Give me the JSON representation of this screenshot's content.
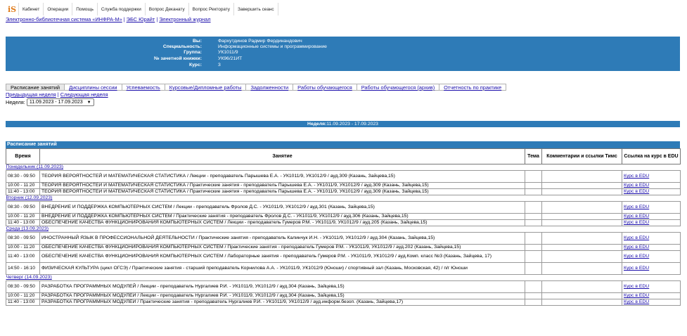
{
  "logo": "iS",
  "top_menu": [
    "Кабинет",
    "Операции",
    "Помощь",
    "Служба поддержки",
    "Вопрос Деканату",
    "Вопрос Ректорату",
    "Завершить сеанс"
  ],
  "ext_links": [
    "Электронно-библиотечная система «ИНФРА-М»",
    "ЭБС Юрайт",
    "Электронный журнал"
  ],
  "ext_links_sep": "|",
  "student": [
    {
      "label": "Вы:",
      "value": "Фархутдинов Радмир Фердинандович"
    },
    {
      "label": "Специальность:",
      "value": "Информационные системы и программирование"
    },
    {
      "label": "Группа:",
      "value": "УК1011/9"
    },
    {
      "label": "№ зачетной книжки:",
      "value": "УК96/21ИТ"
    },
    {
      "label": "Курс:",
      "value": "3"
    }
  ],
  "tabs": [
    "Расписание занятий",
    "Дисциплины сессии",
    "Успеваемость",
    "Курсовые/Дипломные работы",
    "Задолженности",
    "Работы обучающегося",
    "Работы обучающегося (архив)",
    "Отчетность по практике"
  ],
  "week_nav": {
    "prev": "Предыдущая неделя",
    "next": "Следующая неделя",
    "sep": "|"
  },
  "week_select": {
    "label": "Неделя:",
    "value": "11.09.2023 - 17.09.2023"
  },
  "week_bar": {
    "label": "Неделя:",
    "value": "11.09.2023 - 17.09.2023"
  },
  "schedule": {
    "title": "Расписание занятий",
    "headers": [
      "Время",
      "Занятие",
      "Тема",
      "Комментарии и ссылки Тимс",
      "Ссылка на курс в EDU"
    ],
    "link_text": "Курс в EDU",
    "days": [
      {
        "day": "Понедельник (11.09.2023)",
        "rows": [
          {
            "time": "08:30 - 09:50",
            "lesson": "ТЕОРИЯ ВЕРОЯТНОСТЕЙ И МАТЕМАТИЧЕСКАЯ СТАТИСТИКА / Лекции - преподаватель Парышева Е.А. - УК1011/9, УК1012/9 / ауд.309 (Казань, Зайцева,15)",
            "tall": true
          },
          {
            "time": "10:00 - 11:20",
            "lesson": "ТЕОРИЯ ВЕРОЯТНОСТЕЙ И МАТЕМАТИЧЕСКАЯ СТАТИСТИКА / Практические занятия - преподаватель Парышева Е.А. - УК1011/9, УК1012/9 / ауд.309 (Казань, Зайцева,15)",
            "tall": false
          },
          {
            "time": "11:40 - 13:00",
            "lesson": "ТЕОРИЯ ВЕРОЯТНОСТЕЙ И МАТЕМАТИЧЕСКАЯ СТАТИСТИКА / Практические занятия - преподаватель Парышева Е.А. - УК1011/9, УК1012/9 / ауд.309 (Казань, Зайцева,15)",
            "tall": false
          }
        ]
      },
      {
        "day": "Вторник (12.09.2023)",
        "rows": [
          {
            "time": "08:30 - 09:50",
            "lesson": "ВНЕДРЕНИЕ И ПОДДЕРЖКА КОМПЬЮТЕРНЫХ СИСТЕМ / Лекции - преподаватель Фролов Д.С. - УК1011/9, УК1012/9 / ауд.301 (Казань, Зайцева,15)",
            "tall": true
          },
          {
            "time": "10:00 - 11:20",
            "lesson": "ВНЕДРЕНИЕ И ПОДДЕРЖКА КОМПЬЮТЕРНЫХ СИСТЕМ / Практические занятия - преподаватель Фролов Д.С. - УК1011/9, УК1012/9 / ауд.306 (Казань, Зайцева,15)",
            "tall": false
          },
          {
            "time": "11:40 - 13:00",
            "lesson": "ОБЕСПЕЧЕНИЕ КАЧЕСТВА ФУНКЦИОНИРОВАНИЯ КОМПЬЮТЕРНЫХ СИСТЕМ / Лекции - преподаватель Гумеров Р.М. - УК1011/9, УК1012/9 / ауд.205 (Казань, Зайцева,15)",
            "tall": false
          }
        ]
      },
      {
        "day": "Среда (13.09.2023)",
        "rows": [
          {
            "time": "08:30 - 09:50",
            "lesson": "ИНОСТРАННЫЙ ЯЗЫК В ПРОФЕССИОНАЛЬНОЙ ДЕЯТЕЛЬНОСТИ / Практические занятия - преподаватель Калинчук И.Н. - УК1011/9, УК1012/9 / ауд.304 (Казань, Зайцева,15)",
            "tall": true
          },
          {
            "time": "10:00 - 11:20",
            "lesson": "ОБЕСПЕЧЕНИЕ КАЧЕСТВА ФУНКЦИОНИРОВАНИЯ КОМПЬЮТЕРНЫХ СИСТЕМ / Практические занятия - преподаватель Гумеров Р.М. - УК1011/9, УК1012/9 / ауд.202 (Казань, Зайцева,15)",
            "tall": false
          },
          {
            "time": "11:40 - 13:00",
            "lesson": "ОБЕСПЕЧЕНИЕ КАЧЕСТВА ФУНКЦИОНИРОВАНИЯ КОМПЬЮТЕРНЫХ СИСТЕМ / Лабораторные занятия - преподаватель Гумеров Р.М. - УК1011/9, УК1012/9 / ауд.Комп. класс №3 (Казань, Зайцева, 17)",
            "tall": true
          },
          {
            "time": "14:50 - 16:10",
            "lesson": "ФИЗИЧЕСКАЯ КУЛЬТУРА (цикл ОГСЭ) / Практические занятия - старший преподаватель Корнилова А.А. - УК1011/9, УК1012/9 (Юноши) / спортивный зал (Казань, Московская, 42) / п/г Юноши",
            "tall": true
          }
        ]
      },
      {
        "day": "Четверг (14.09.2023)",
        "rows": [
          {
            "time": "08:30 - 09:50",
            "lesson": "РАЗРАБОТКА ПРОГРАММНЫХ МОДУЛЕЙ / Лекции - преподаватель Нургалиев Р.И. - УК1011/9, УК1012/9 / ауд.304 (Казань, Зайцева,15)",
            "tall": true
          },
          {
            "time": "10:00 - 11:20",
            "lesson": "РАЗРАБОТКА ПРОГРАММНЫХ МОДУЛЕЙ / Лекции - преподаватель Нургалиев Р.И. - УК1011/9, УК1012/9 / ауд.304 (Казань, Зайцева,15)",
            "tall": false
          },
          {
            "time": "11:40 - 13:00",
            "lesson": "РАЗРАБОТКА ПРОГРАММНЫХ МОДУЛЕЙ / Практические занятия - преподаватель Нургалиев Р.И. - УК1011/9, УК1012/9 / ауд.информ.безоп. (Казань, Зайцева,17)",
            "tall": false
          }
        ]
      }
    ]
  },
  "colors": {
    "header_bg": "#2e7bb7",
    "link": "#1a0dab",
    "logo": "#e07b1a"
  }
}
